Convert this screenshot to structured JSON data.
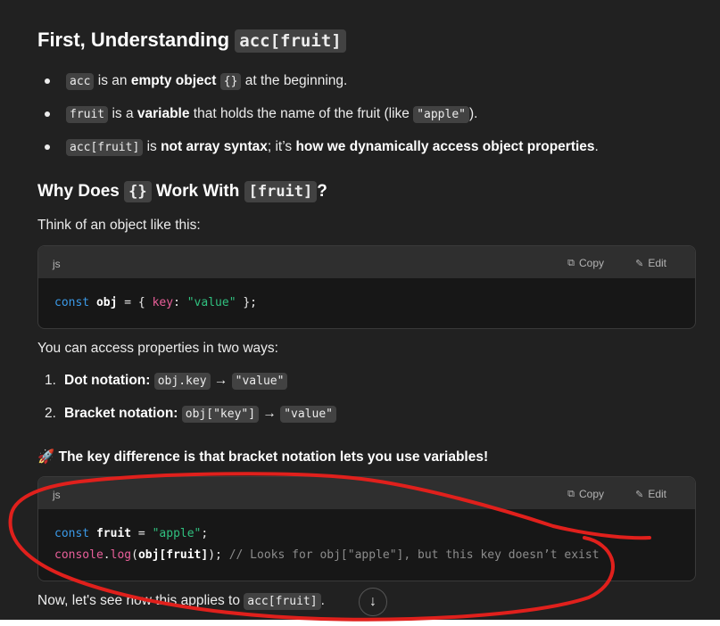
{
  "heading1": {
    "text": "First, Understanding",
    "code": "acc[fruit]"
  },
  "bullets": [
    {
      "code": "acc",
      "t1": " is an ",
      "b1": "empty object",
      "code2": "{}",
      "t2": " at the beginning."
    },
    {
      "code": "fruit",
      "t1": " is a ",
      "b1": "variable",
      "t2": " that holds the name of the fruit (like ",
      "code2": "\"apple\"",
      "t3": ")."
    },
    {
      "code": "acc[fruit]",
      "t1": " is ",
      "b1": "not array syntax",
      "t2": "; it’s ",
      "b2": "how we dynamically access object properties",
      "t3": "."
    }
  ],
  "heading2": {
    "pre": "Why Does",
    "code1": "{}",
    "mid": "Work With",
    "code2": "[fruit]",
    "post": "?"
  },
  "para1": "Think of an object like this:",
  "codeblock1": {
    "lang": "js",
    "copy_label": "Copy",
    "edit_label": "Edit",
    "tokens": {
      "kw": "const",
      "var": "obj",
      "p1": " = { ",
      "prop": "key",
      "p2": ": ",
      "str": "\"value\"",
      "p3": " };"
    }
  },
  "para2": "You can access properties in two ways:",
  "numbered": [
    {
      "n": "1.",
      "label": "Dot notation:",
      "code": "obj.key",
      "arrow": "→",
      "result": "\"value\""
    },
    {
      "n": "2.",
      "label": "Bracket notation:",
      "code": "obj[\"key\"]",
      "arrow": "→",
      "result": "\"value\""
    }
  ],
  "para3": {
    "emoji": "🚀",
    "text": "The key difference is that bracket notation lets you use variables!"
  },
  "codeblock2": {
    "lang": "js",
    "copy_label": "Copy",
    "edit_label": "Edit",
    "line1": {
      "kw": "const",
      "var": "fruit",
      "p1": " = ",
      "str": "\"apple\"",
      "p2": ";"
    },
    "line2": {
      "obj": "console",
      "dot": ".",
      "fn": "log",
      "p1": "(",
      "args": "obj[fruit]",
      "p2": "); ",
      "comment": "// Looks for obj[\"apple\"], but this key doesn’t exist"
    }
  },
  "para4": {
    "text": "Now, let's see how this applies to ",
    "code": "acc[fruit]",
    "end": "."
  },
  "scroll_button_icon": "arrow-down-icon",
  "annotation_color": "#e0201c"
}
